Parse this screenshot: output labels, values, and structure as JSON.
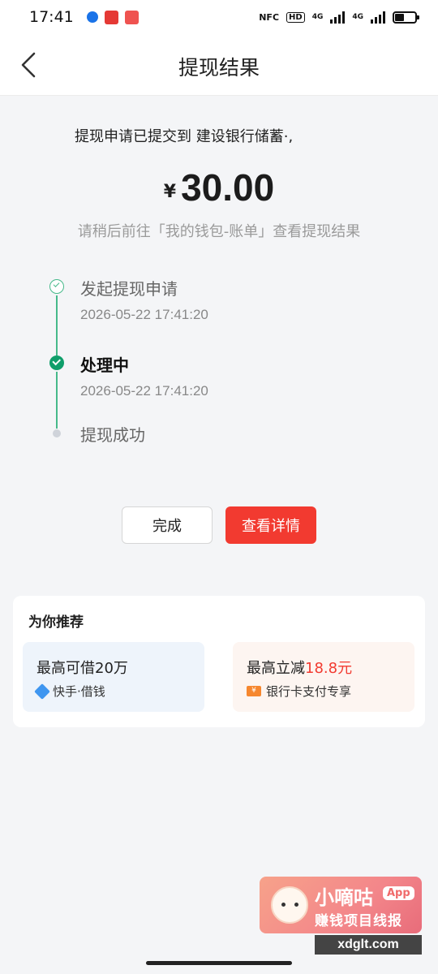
{
  "status_bar": {
    "time": "17:41",
    "indicators": [
      "NFC",
      "HD",
      "4G",
      "4G"
    ]
  },
  "nav": {
    "title": "提现结果",
    "back_icon": "chevron-left-icon"
  },
  "result": {
    "submitted_text": "提现申请已提交到 建设银行储蓄·,",
    "currency": "¥",
    "amount": "30.00",
    "hint": "请稍后前往「我的钱包-账单」查看提现结果"
  },
  "timeline": [
    {
      "title": "发起提现申请",
      "time": "2026-05-22 17:41:20",
      "state": "done"
    },
    {
      "title": "处理中",
      "time": "2026-05-22 17:41:20",
      "state": "active"
    },
    {
      "title": "提现成功",
      "time": "",
      "state": "pending"
    }
  ],
  "actions": {
    "done_label": "完成",
    "detail_label": "查看详情"
  },
  "recommend": {
    "title": "为你推荐",
    "cards": [
      {
        "main": "最高可借20万",
        "sub": "快手·借钱",
        "icon": "diamond-icon"
      },
      {
        "main_prefix": "最高立减",
        "main_highlight": "18.8元",
        "sub": "银行卡支付专享",
        "icon": "ticket-icon"
      }
    ]
  },
  "watermark": {
    "brand": "小嘀咕",
    "badge": "App",
    "slogan": "赚钱项目线报",
    "url": "xdglt.com"
  },
  "colors": {
    "accent_red": "#f23a30",
    "success_green": "#46b98a",
    "background": "#f4f5f7"
  }
}
